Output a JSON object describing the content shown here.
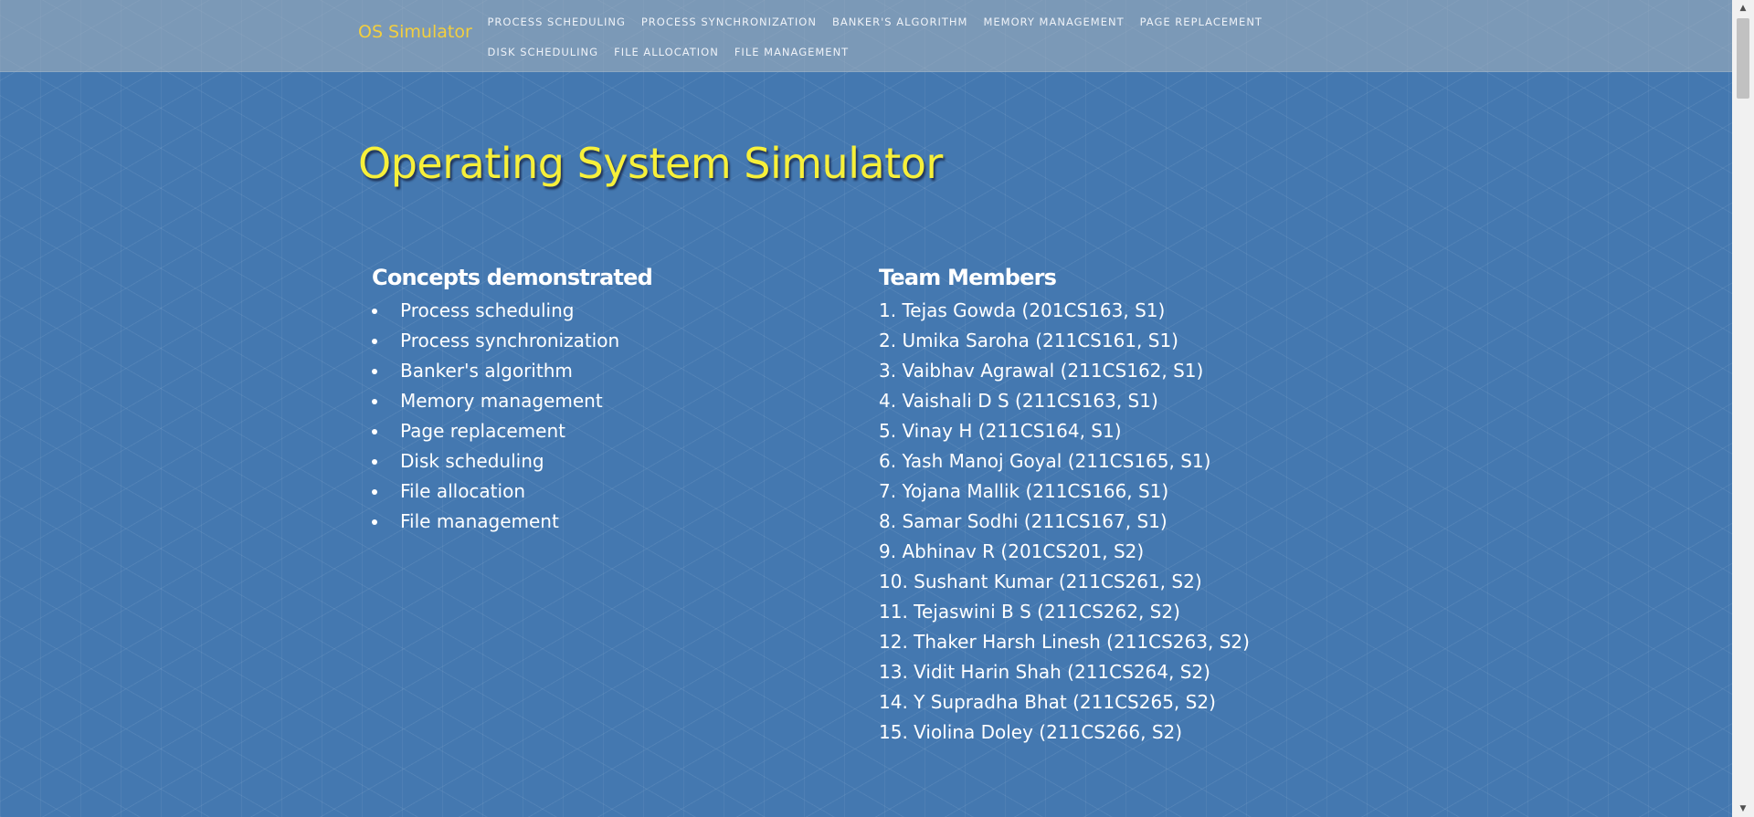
{
  "navbar": {
    "brand": "OS Simulator",
    "links": [
      "PROCESS SCHEDULING",
      "PROCESS SYNCHRONIZATION",
      "BANKER'S ALGORITHM",
      "MEMORY MANAGEMENT",
      "PAGE REPLACEMENT",
      "DISK SCHEDULING",
      "FILE ALLOCATION",
      "FILE MANAGEMENT"
    ]
  },
  "main": {
    "title": "Operating System Simulator",
    "concepts": {
      "heading": "Concepts demonstrated",
      "items": [
        "Process scheduling",
        "Process synchronization",
        "Banker's algorithm",
        "Memory management",
        "Page replacement",
        "Disk scheduling",
        "File allocation",
        "File management"
      ]
    },
    "team": {
      "heading": "Team Members",
      "members": [
        "1. Tejas Gowda (201CS163, S1)",
        "2. Umika Saroha (211CS161, S1)",
        "3. Vaibhav Agrawal (211CS162, S1)",
        "4. Vaishali D S (211CS163, S1)",
        "5. Vinay H (211CS164, S1)",
        "6. Yash Manoj Goyal (211CS165, S1)",
        "7. Yojana Mallik (211CS166, S1)",
        "8. Samar Sodhi (211CS167, S1)",
        "9. Abhinav R (201CS201, S2)",
        "10. Sushant Kumar (211CS261, S2)",
        "11. Tejaswini B S (211CS262, S2)",
        "12. Thaker Harsh Linesh (211CS263, S2)",
        "13. Vidit Harin Shah (211CS264, S2)",
        "14. Y Supradha Bhat (211CS265, S2)",
        "15. Violina Doley (211CS266, S2)"
      ]
    }
  },
  "colors": {
    "background": "#4478b0",
    "brand": "#f3cf3e",
    "title": "#f7f03a",
    "text": "#ffffff"
  },
  "scrollbar": {
    "up_icon": "scroll-up-arrow-icon",
    "down_icon": "scroll-down-arrow-icon"
  }
}
